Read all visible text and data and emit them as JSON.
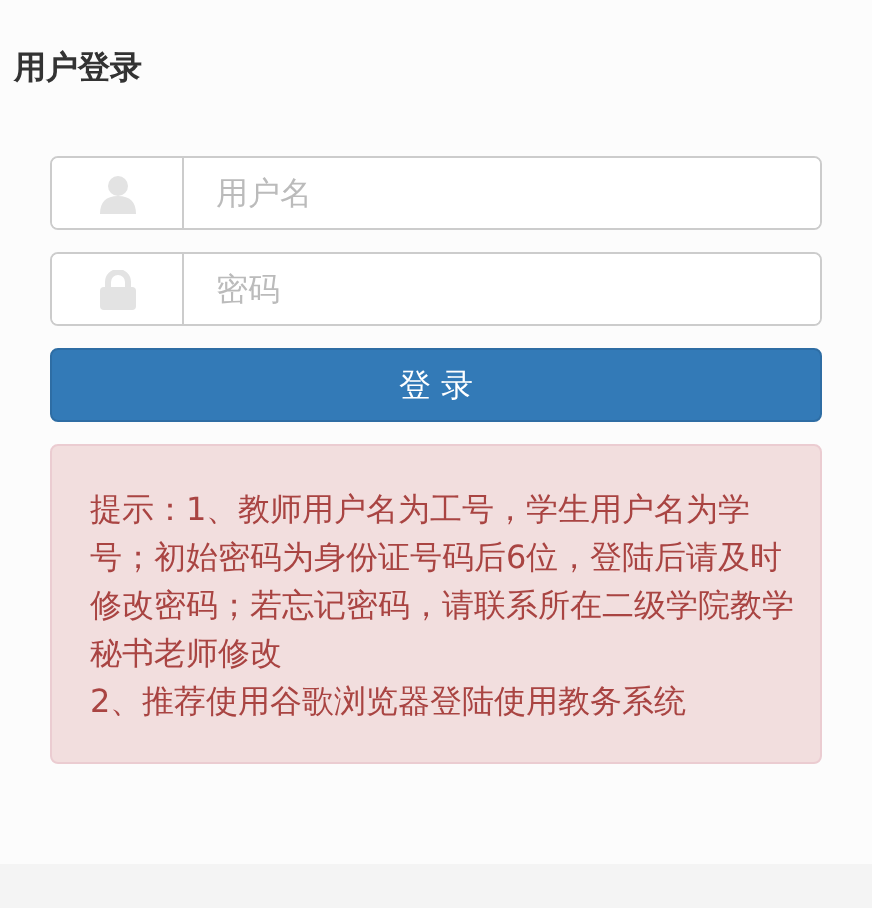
{
  "title": "用户登录",
  "fields": [
    {
      "kind": "user",
      "placeholder": "用户名"
    },
    {
      "kind": "password",
      "placeholder": "密码"
    }
  ],
  "login_button": "登 录",
  "notice": [
    "提示：1、教师用户名为工号，学生用户名为学号；初始密码为身份证号码后6位，登陆后请及时修改密码；若忘记密码，请联系所在二级学院教学秘书老师修改",
    "2、推荐使用谷歌浏览器登陆使用教务系统"
  ]
}
